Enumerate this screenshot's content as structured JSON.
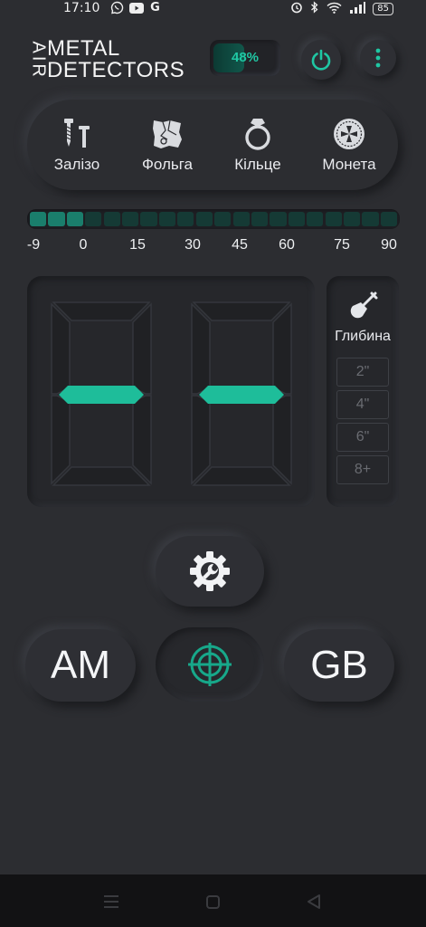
{
  "status_bar": {
    "time": "17:10",
    "notification_icons": [
      "viber-icon",
      "youtube-icon",
      "google-icon"
    ],
    "right_icons": [
      "alarm-icon",
      "bluetooth-icon",
      "wifi-icon",
      "signal-icon"
    ],
    "battery": "85"
  },
  "header": {
    "brand_vertical": "AIR",
    "brand_line1": "METAL",
    "brand_line2": "DETECTORS",
    "battery_percent": "48%",
    "battery_level": 0.48,
    "accent_color": "#1fc7a3"
  },
  "modes": {
    "items": [
      {
        "label": "Залізо",
        "icon": "screw-nail-icon"
      },
      {
        "label": "Фольга",
        "icon": "foil-icon"
      },
      {
        "label": "Кільце",
        "icon": "ring-icon"
      },
      {
        "label": "Монета",
        "icon": "coin-icon"
      }
    ]
  },
  "meter": {
    "labels": [
      "-9",
      "0",
      "15",
      "30",
      "45",
      "60",
      "75",
      "90"
    ],
    "segments_total": 20,
    "segments_on": 3
  },
  "display": {
    "value": "--"
  },
  "depth": {
    "icon": "shovel-icon",
    "title": "Глибина",
    "options": [
      "2\"",
      "4\"",
      "6\"",
      "8+"
    ]
  },
  "controls": {
    "settings_icon": "settings-wrench-icon",
    "left_label": "AM",
    "center_icon": "target-icon",
    "right_label": "GB"
  },
  "nav_bar": {
    "icons": [
      "menu-icon",
      "home-icon",
      "back-icon"
    ]
  }
}
